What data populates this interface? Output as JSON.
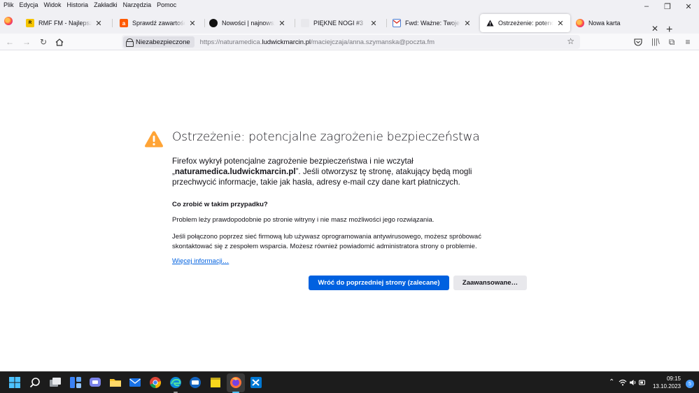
{
  "menu": [
    "Plik",
    "Edycja",
    "Widok",
    "Historia",
    "Zakładki",
    "Narzędzia",
    "Pomoc"
  ],
  "window_controls": [
    "–",
    "❐",
    "✕"
  ],
  "tabs": [
    {
      "title": "RMF FM - Najlepsza muzyka",
      "icon": "rmf-favicon"
    },
    {
      "title": "Sprawdź zawartość Twojego",
      "icon": "allegro-favicon"
    },
    {
      "title": "Nowości | najnowsze bielizna",
      "icon": "shop-favicon"
    },
    {
      "title": "PIĘKNE NOGI #3",
      "icon": "page-favicon"
    },
    {
      "title": "Fwd: Ważne: Twoje Zawiadomienie",
      "icon": "mail-favicon"
    },
    {
      "title": "Ostrzeżenie: potencjalne zagrożenie",
      "icon": "warning-icon",
      "active": true
    },
    {
      "title": "Nowa karta",
      "icon": "firefox-icon"
    }
  ],
  "urlbar": {
    "security_label": "Niezabezpieczone",
    "url_prefix": "https://naturamedica.",
    "url_domain": "ludwickmarcin.pl",
    "url_path": "/maciejczaja/anna.szymanska@poczta.fm"
  },
  "page": {
    "title": "Ostrzeżenie: potencjalne zagrożenie bezpieczeństwa",
    "intro_1": "Firefox wykrył potencjalne zagrożenie bezpieczeństwa i nie wczytał",
    "intro_quote_open": "„",
    "intro_domain": "naturamedica.ludwickmarcin.pl",
    "intro_2": "”. Jeśli otworzysz tę stronę, atakujący będą mogli przechwycić informacje, takie jak hasła, adresy e-mail czy dane kart płatniczych.",
    "what_to_do": "Co zrobić w takim przypadku?",
    "para_1": "Problem leży prawdopodobnie po stronie witryny i nie masz możliwości jego rozwiązania.",
    "para_2": "Jeśli połączono poprzez sieć firmową lub używasz oprogramowania antywirusowego, możesz spróbować skontaktować się z zespołem wsparcia. Możesz również powiadomić administratora strony o problemie.",
    "more_info": "Więcej informacji…",
    "back_button": "Wróć do poprzedniej strony (zalecane)",
    "advanced_button": "Zaawansowane…"
  },
  "taskbar": {
    "time": "09:15",
    "date": "13.10.2023",
    "notifications": "5"
  },
  "colors": {
    "accent": "#0061e0",
    "warning": "#ffa436",
    "taskbar": "#1c1c1c"
  }
}
